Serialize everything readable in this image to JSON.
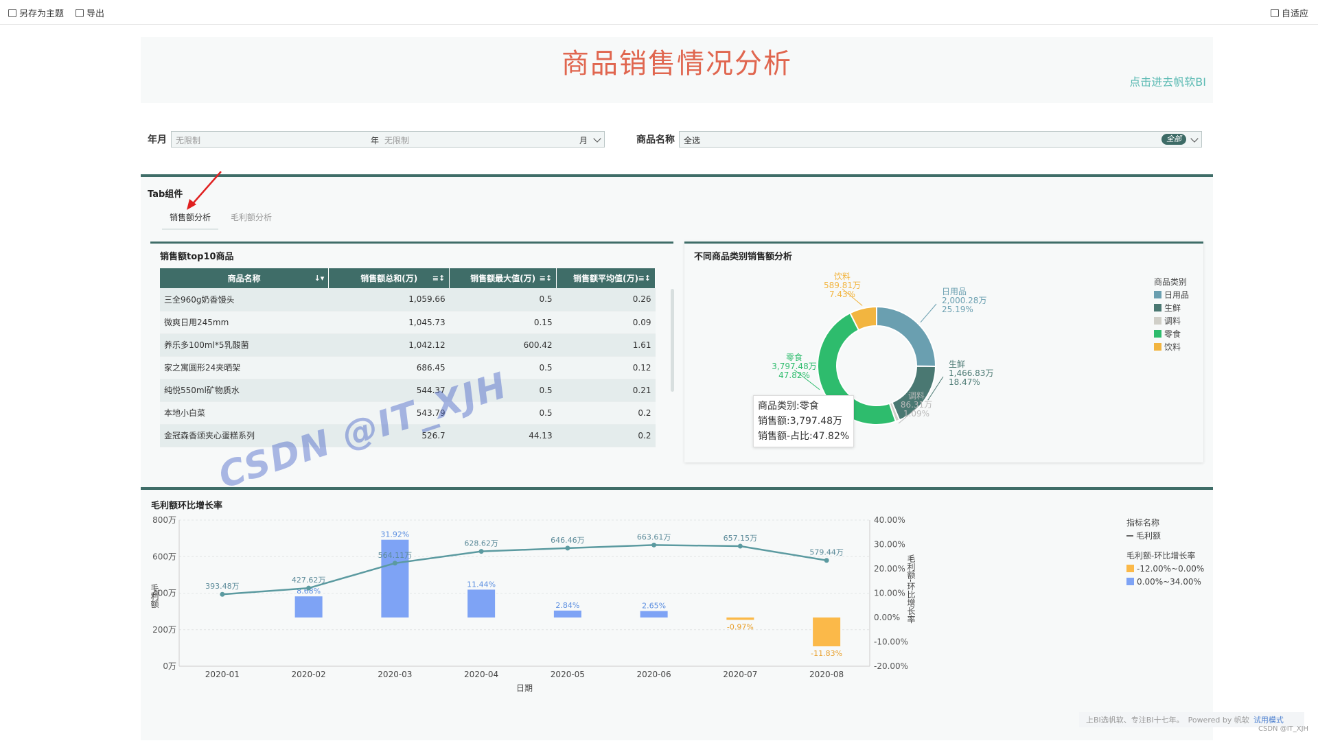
{
  "toolbar": {
    "save_theme": "另存为主题",
    "export": "导出",
    "adapt": "自适应"
  },
  "header": {
    "title": "商品销售情况分析",
    "bi_link": "点击进去帆软BI"
  },
  "filters": {
    "ym_label": "年月",
    "year_placeholder": "无限制",
    "year_unit": "年",
    "month_placeholder": "无限制",
    "month_unit": "月",
    "product_label": "商品名称",
    "product_value": "全选",
    "product_pill": "全部"
  },
  "tabs_section": {
    "title": "Tab组件",
    "tabs": [
      {
        "label": "销售额分析"
      },
      {
        "label": "毛利额分析"
      }
    ]
  },
  "top10": {
    "title": "销售额top10商品",
    "columns": [
      "商品名称",
      "销售额总和(万)",
      "销售额最大值(万)",
      "销售额平均值(万)"
    ],
    "rows": [
      [
        "三全960g奶香馒头",
        "1,059.66",
        "0.5",
        "0.26"
      ],
      [
        "微爽日用245mm",
        "1,045.73",
        "0.15",
        "0.09"
      ],
      [
        "养乐多100ml*5乳酸菌",
        "1,042.12",
        "600.42",
        "1.61"
      ],
      [
        "家之寓圆形24夹晒架",
        "686.45",
        "0.5",
        "0.12"
      ],
      [
        "纯悦550ml矿物质水",
        "544.37",
        "0.5",
        "0.21"
      ],
      [
        "本地小白菜",
        "543.79",
        "0.5",
        "0.2"
      ],
      [
        "金冠森香颂夹心蛋糕系列",
        "526.7",
        "44.13",
        "0.2"
      ]
    ]
  },
  "donut": {
    "title": "不同商品类别销售额分析",
    "legend_title": "商品类别",
    "labels": [
      {
        "name": "日用品",
        "value": "2,000.28万",
        "pct": "25.19%"
      },
      {
        "name": "生鲜",
        "value": "1,466.83万",
        "pct": "18.47%"
      },
      {
        "name": "调料",
        "value": "86.31万",
        "pct": "1.09%"
      },
      {
        "name": "零食",
        "value": "3,797.48万",
        "pct": "47.82%"
      },
      {
        "name": "饮料",
        "value": "589.81万",
        "pct": "7.43%"
      }
    ],
    "tooltip": {
      "line1": "商品类别:零食",
      "line2": "销售额:3,797.48万",
      "line3": "销售额-占比:47.82%"
    }
  },
  "combo": {
    "title": "毛利额环比增长率",
    "xlabel": "日期",
    "ylabel_left": "毛利额",
    "ylabel_right": "毛利额-环比增长率",
    "left_ticks": [
      "800万",
      "600万",
      "400万",
      "200万",
      "0万"
    ],
    "right_ticks": [
      "40.00%",
      "30.00%",
      "20.00%",
      "10.00%",
      "0.00%",
      "-10.00%",
      "-20.00%"
    ],
    "legend": {
      "title1": "指标名称",
      "line_item": "毛利额",
      "title2": "毛利额-环比增长率",
      "bucket_neg": "-12.00%~0.00%",
      "bucket_pos": "0.00%~34.00%"
    }
  },
  "chart_data": {
    "type": "bar",
    "categories": [
      "2020-01",
      "2020-02",
      "2020-03",
      "2020-04",
      "2020-05",
      "2020-06",
      "2020-07",
      "2020-08"
    ],
    "series": [
      {
        "name": "毛利额",
        "kind": "line",
        "values": [
          393.48,
          427.62,
          564.11,
          628.62,
          646.46,
          663.61,
          657.15,
          579.44
        ],
        "labels": [
          "393.48万",
          "427.62万",
          "564.11万",
          "628.62万",
          "646.46万",
          "663.61万",
          "657.15万",
          "579.44万"
        ],
        "color": "#5b9aa0"
      },
      {
        "name": "毛利额-环比增长率",
        "kind": "bar",
        "values": [
          null,
          8.68,
          31.92,
          11.44,
          2.84,
          2.65,
          -0.97,
          -11.83
        ],
        "labels": [
          "",
          "8.68%",
          "31.92%",
          "11.44%",
          "2.84%",
          "2.65%",
          "-0.97%",
          "-11.83%"
        ]
      }
    ],
    "ylim_left": [
      0,
      800
    ],
    "ylim_right": [
      -20,
      40
    ],
    "colors": {
      "pos": "#7ea3f5",
      "neg": "#fbb949",
      "line": "#5b9aa0"
    }
  },
  "donut_data": {
    "values": [
      2000.28,
      1466.83,
      86.31,
      3797.48,
      589.81
    ],
    "colors": [
      "#6a9fb0",
      "#4a7872",
      "#d0cfc8",
      "#2ebc6d",
      "#f2b540"
    ]
  },
  "footer": {
    "text": "上BI选帆软、专注BI十七年。",
    "powered": "Powered by 帆软",
    "trial": "试用模式",
    "csdn": "CSDN @IT_XJH"
  },
  "watermark": "CSDN @IT_XJH"
}
